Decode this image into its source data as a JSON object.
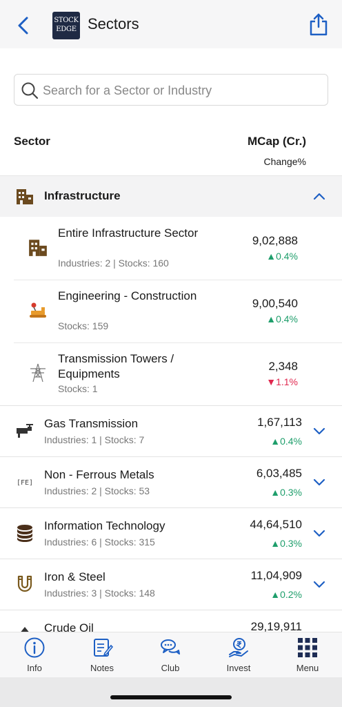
{
  "header": {
    "title": "Sectors",
    "logo_line1": "STOCK",
    "logo_line2": "EDGE"
  },
  "search": {
    "placeholder": "Search for a Sector or Industry",
    "value": ""
  },
  "columns": {
    "sector": "Sector",
    "mcap": "MCap (Cr.)",
    "change": "Change%"
  },
  "expanded_group": {
    "name": "Infrastructure",
    "icon": "buildings-icon",
    "items": [
      {
        "name": "Entire Infrastructure Sector",
        "meta": "Industries: 2 | Stocks: 160",
        "mcap": "9,02,888",
        "change": "▲0.4%",
        "direction": "up",
        "icon": "buildings-icon"
      },
      {
        "name": "Engineering - Construction",
        "meta": "Stocks: 159",
        "mcap": "9,00,540",
        "change": "▲0.4%",
        "direction": "up",
        "icon": "bulldozer-icon"
      },
      {
        "name": "Transmission Towers / Equipments",
        "meta": "Stocks: 1",
        "mcap": "2,348",
        "change": "▼1.1%",
        "direction": "down",
        "icon": "transmission-tower-icon"
      }
    ]
  },
  "sectors": [
    {
      "name": "Gas Transmission",
      "meta": "Industries: 1 | Stocks: 7",
      "mcap": "1,67,113",
      "change": "▲0.4%",
      "direction": "up",
      "icon": "gas-pipe-icon"
    },
    {
      "name": "Non - Ferrous Metals",
      "meta": "Industries: 2 | Stocks: 53",
      "mcap": "6,03,485",
      "change": "▲0.3%",
      "direction": "up",
      "icon": "fe-element-icon",
      "icon_text": "[FE]"
    },
    {
      "name": "Information Technology",
      "meta": "Industries: 6 | Stocks: 315",
      "mcap": "44,64,510",
      "change": "▲0.3%",
      "direction": "up",
      "icon": "database-icon"
    },
    {
      "name": "Iron & Steel",
      "meta": "Industries: 3 | Stocks: 148",
      "mcap": "11,04,909",
      "change": "▲0.2%",
      "direction": "up",
      "icon": "magnet-icon"
    },
    {
      "name": "Crude Oil",
      "meta": "",
      "mcap": "29,19,911",
      "change": "",
      "direction": "up",
      "icon": "oil-drop-icon"
    }
  ],
  "nav": [
    {
      "label": "Info",
      "icon": "info-icon"
    },
    {
      "label": "Notes",
      "icon": "notes-icon"
    },
    {
      "label": "Club",
      "icon": "chat-bubbles-icon"
    },
    {
      "label": "Invest",
      "icon": "rupee-hand-icon"
    },
    {
      "label": "Menu",
      "icon": "grid-menu-icon"
    }
  ],
  "colors": {
    "accent": "#1d5fc4",
    "up": "#1e9e6b",
    "down": "#e0284f",
    "icon_brown": "#6b4a1f"
  }
}
